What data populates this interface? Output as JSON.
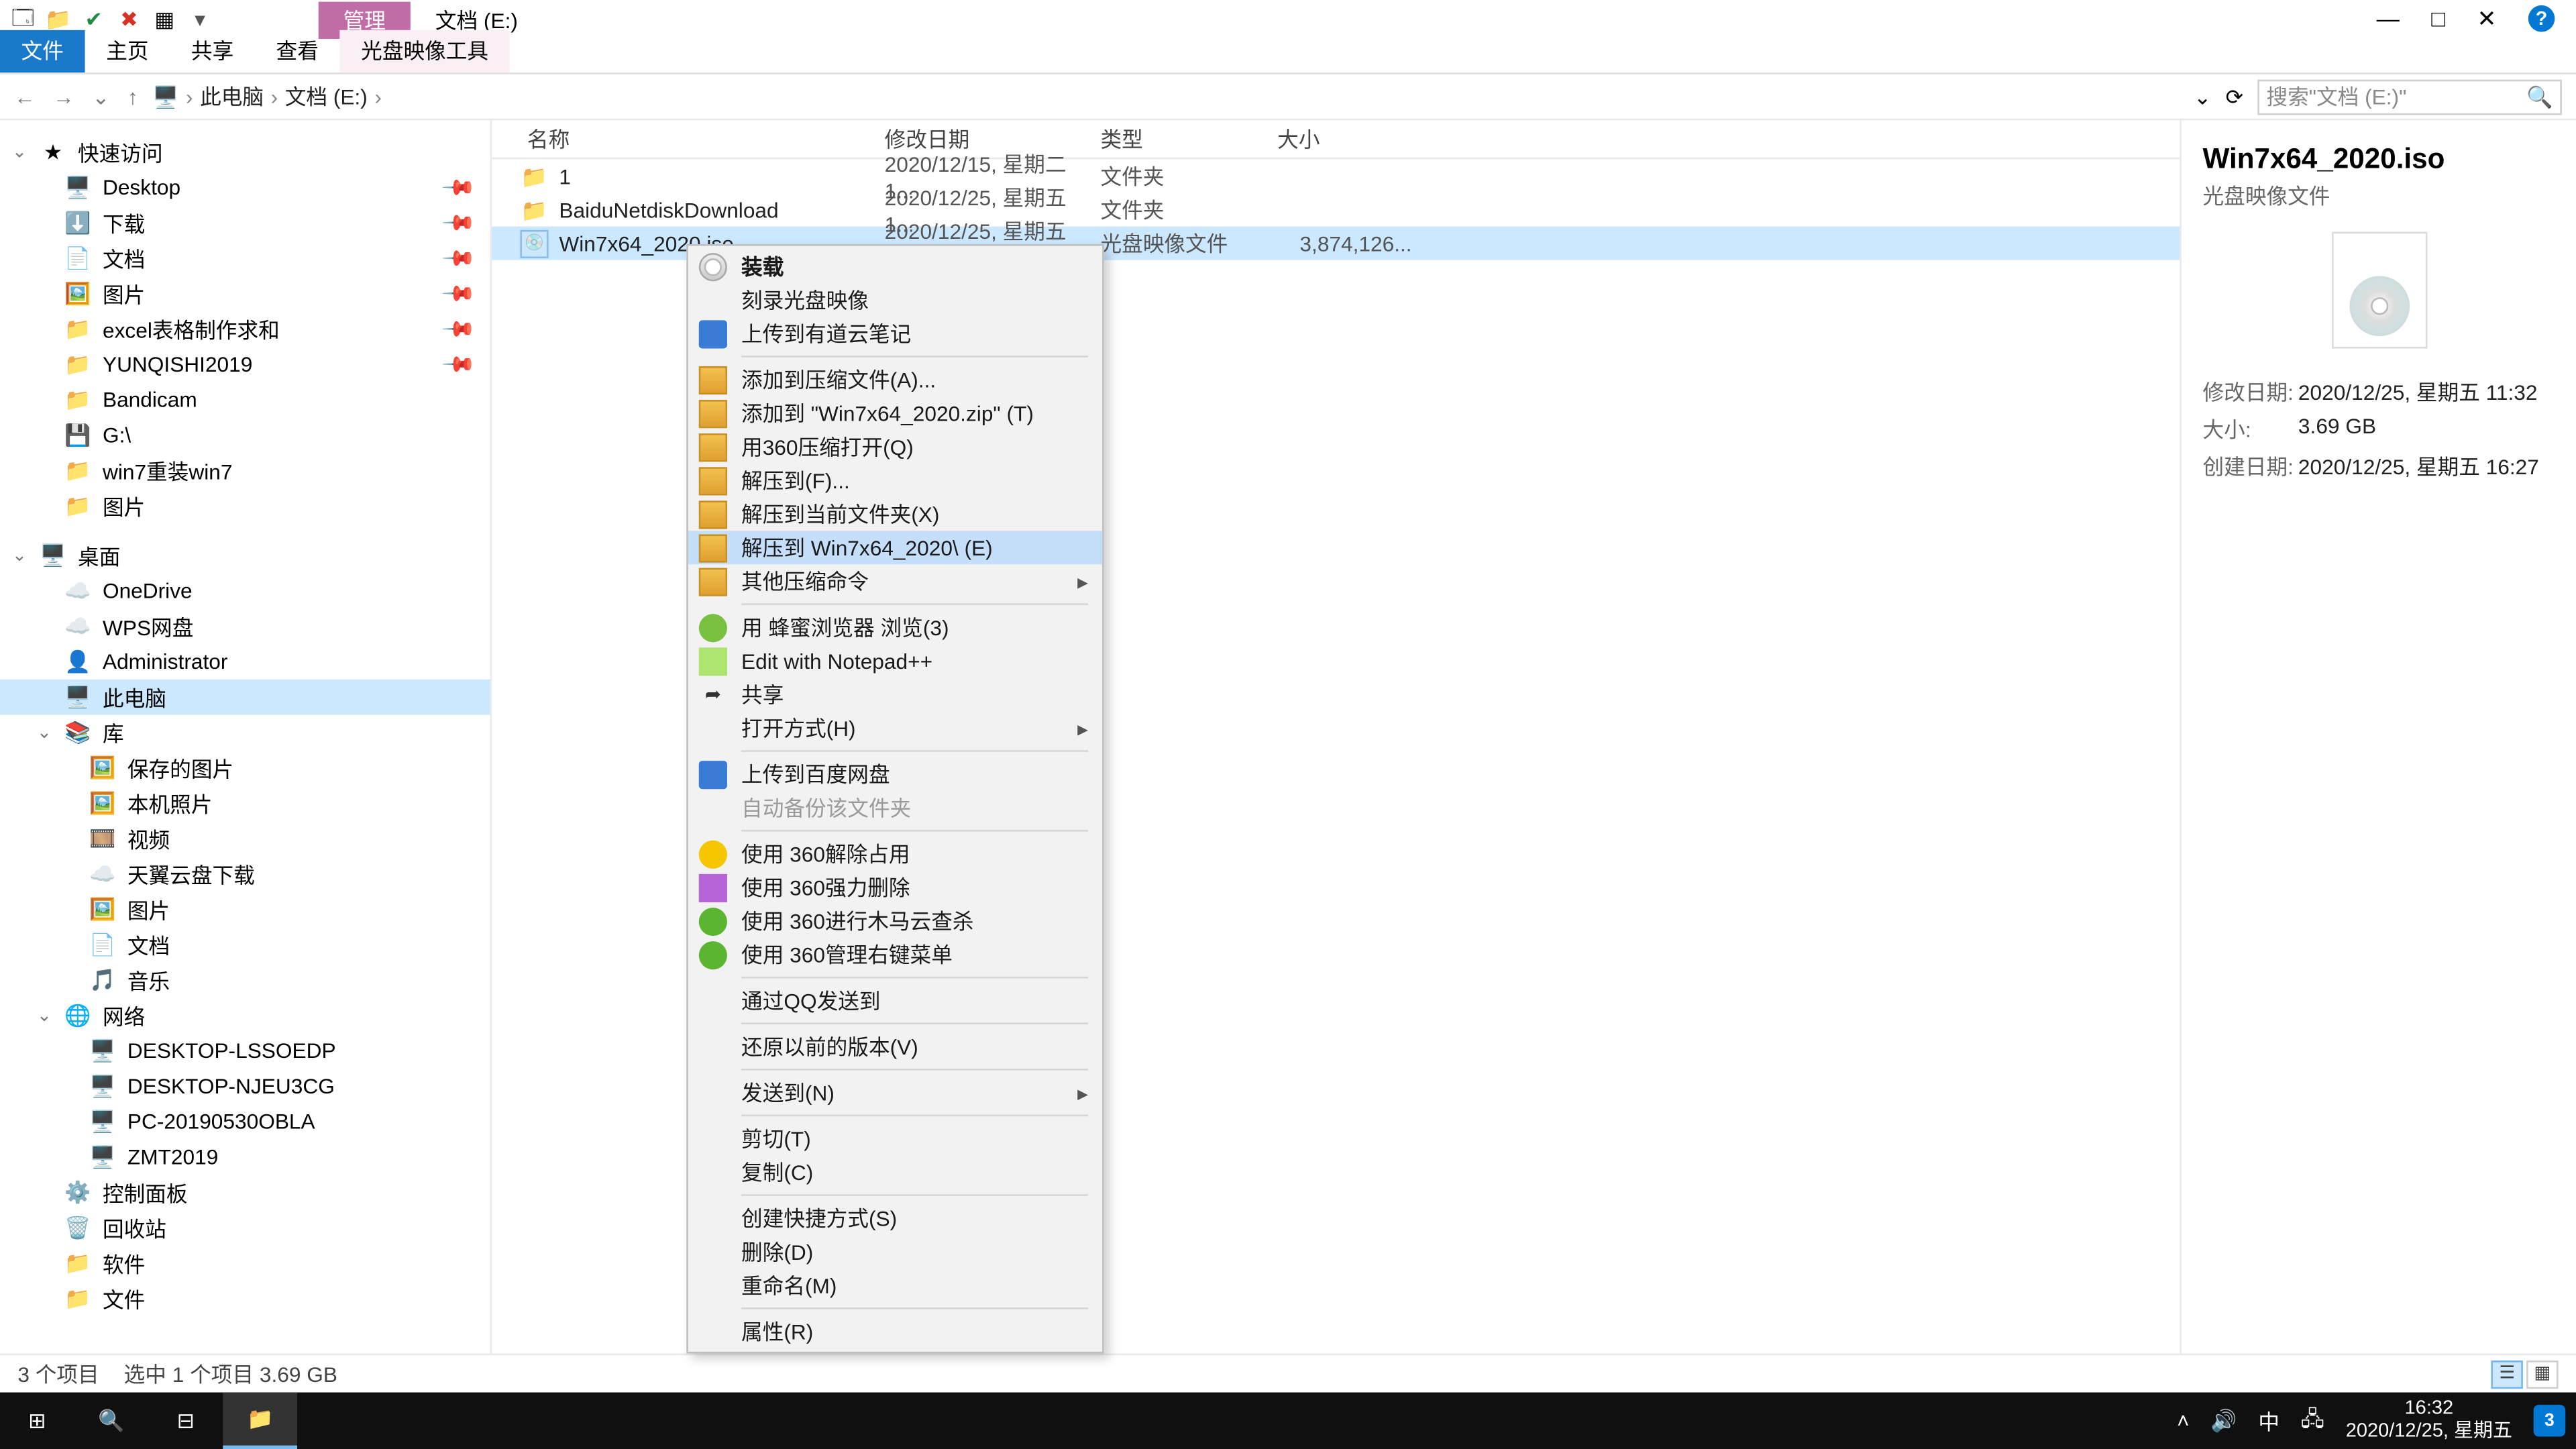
{
  "window": {
    "tabs_contextual": {
      "manage": "管理",
      "location": "文档 (E:)"
    },
    "ctl": {
      "min": "—",
      "max": "□",
      "close": "✕",
      "help": "?"
    }
  },
  "ribbon": {
    "file": "文件",
    "home": "主页",
    "share": "共享",
    "view": "查看",
    "disctools": "光盘映像工具"
  },
  "address": {
    "back": "←",
    "fwd": "→",
    "up": "↑",
    "crumbs": [
      "此电脑",
      "文档 (E:)"
    ],
    "dropdown": "⌄",
    "refresh": "⟳",
    "search_placeholder": "搜索\"文档 (E:)\"",
    "mag": "🔍"
  },
  "nav": {
    "quick": {
      "label": "快速访问",
      "items": [
        {
          "icon": "🖥️",
          "label": "Desktop",
          "pin": true
        },
        {
          "icon": "⬇️",
          "label": "下载",
          "pin": true
        },
        {
          "icon": "📄",
          "label": "文档",
          "pin": true
        },
        {
          "icon": "🖼️",
          "label": "图片",
          "pin": true
        },
        {
          "icon": "📁",
          "label": "excel表格制作求和",
          "pin": true
        },
        {
          "icon": "📁",
          "label": "YUNQISHI2019",
          "pin": true
        },
        {
          "icon": "📁",
          "label": "Bandicam"
        },
        {
          "icon": "💾",
          "label": "G:\\"
        },
        {
          "icon": "📁",
          "label": "win7重装win7"
        },
        {
          "icon": "📁",
          "label": "图片"
        }
      ]
    },
    "desktop": {
      "label": "桌面",
      "items": [
        {
          "icon": "☁️",
          "label": "OneDrive"
        },
        {
          "icon": "☁️",
          "label": "WPS网盘"
        },
        {
          "icon": "👤",
          "label": "Administrator"
        },
        {
          "icon": "🖥️",
          "label": "此电脑",
          "sel": true
        },
        {
          "icon": "📚",
          "label": "库",
          "expanded": true,
          "children": [
            {
              "icon": "🖼️",
              "label": "保存的图片"
            },
            {
              "icon": "🖼️",
              "label": "本机照片"
            },
            {
              "icon": "🎞️",
              "label": "视频"
            },
            {
              "icon": "☁️",
              "label": "天翼云盘下载"
            },
            {
              "icon": "🖼️",
              "label": "图片"
            },
            {
              "icon": "📄",
              "label": "文档"
            },
            {
              "icon": "🎵",
              "label": "音乐"
            }
          ]
        },
        {
          "icon": "🌐",
          "label": "网络",
          "expanded": true,
          "children": [
            {
              "icon": "🖥️",
              "label": "DESKTOP-LSSOEDP"
            },
            {
              "icon": "🖥️",
              "label": "DESKTOP-NJEU3CG"
            },
            {
              "icon": "🖥️",
              "label": "PC-20190530OBLA"
            },
            {
              "icon": "🖥️",
              "label": "ZMT2019"
            }
          ]
        },
        {
          "icon": "⚙️",
          "label": "控制面板"
        },
        {
          "icon": "🗑️",
          "label": "回收站"
        },
        {
          "icon": "📁",
          "label": "软件"
        },
        {
          "icon": "📁",
          "label": "文件"
        }
      ]
    }
  },
  "columns": {
    "name": "名称",
    "date": "修改日期",
    "type": "类型",
    "size": "大小"
  },
  "rows": [
    {
      "icon": "folder",
      "name": "1",
      "date": "2020/12/15, 星期二 1...",
      "type": "文件夹",
      "size": ""
    },
    {
      "icon": "folder",
      "name": "BaiduNetdiskDownload",
      "date": "2020/12/25, 星期五 1...",
      "type": "文件夹",
      "size": ""
    },
    {
      "icon": "iso",
      "name": "Win7x64_2020.iso",
      "date": "2020/12/25, 星期五 1...",
      "type": "光盘映像文件",
      "size": "3,874,126...",
      "sel": true
    }
  ],
  "details": {
    "title": "Win7x64_2020.iso",
    "sub": "光盘映像文件",
    "props": [
      {
        "k": "修改日期:",
        "v": "2020/12/25, 星期五 11:32"
      },
      {
        "k": "大小:",
        "v": "3.69 GB"
      },
      {
        "k": "创建日期:",
        "v": "2020/12/25, 星期五 16:27"
      }
    ]
  },
  "status": {
    "count": "3 个项目",
    "selection": "选中 1 个项目  3.69 GB"
  },
  "ctx": [
    {
      "t": "装载",
      "bold": true,
      "ico": "disc"
    },
    {
      "t": "刻录光盘映像"
    },
    {
      "t": "上传到有道云笔记",
      "ico": "bluebox"
    },
    {
      "sep": true
    },
    {
      "t": "添加到压缩文件(A)...",
      "ico": "archive"
    },
    {
      "t": "添加到 \"Win7x64_2020.zip\" (T)",
      "ico": "archive"
    },
    {
      "t": "用360压缩打开(Q)",
      "ico": "archive"
    },
    {
      "t": "解压到(F)...",
      "ico": "archive"
    },
    {
      "t": "解压到当前文件夹(X)",
      "ico": "archive"
    },
    {
      "t": "解压到 Win7x64_2020\\ (E)",
      "ico": "archive",
      "hov": true
    },
    {
      "t": "其他压缩命令",
      "ico": "archive",
      "sub": true
    },
    {
      "sep": true
    },
    {
      "t": "用 蜂蜜浏览器 浏览(3)",
      "ico": "green"
    },
    {
      "t": "Edit with Notepad++",
      "ico": "notepp"
    },
    {
      "t": "共享",
      "ico": "share"
    },
    {
      "t": "打开方式(H)",
      "sub": true
    },
    {
      "sep": true
    },
    {
      "t": "上传到百度网盘",
      "ico": "bluebox"
    },
    {
      "t": "自动备份该文件夹",
      "dis": true
    },
    {
      "sep": true
    },
    {
      "t": "使用 360解除占用",
      "ico": "yellow"
    },
    {
      "t": "使用 360强力删除",
      "ico": "purple"
    },
    {
      "t": "使用 360进行木马云查杀",
      "ico": "greenround"
    },
    {
      "t": "使用 360管理右键菜单",
      "ico": "greenround"
    },
    {
      "sep": true
    },
    {
      "t": "通过QQ发送到"
    },
    {
      "sep": true
    },
    {
      "t": "还原以前的版本(V)"
    },
    {
      "sep": true
    },
    {
      "t": "发送到(N)",
      "sub": true
    },
    {
      "sep": true
    },
    {
      "t": "剪切(T)"
    },
    {
      "t": "复制(C)"
    },
    {
      "sep": true
    },
    {
      "t": "创建快捷方式(S)"
    },
    {
      "t": "删除(D)"
    },
    {
      "t": "重命名(M)"
    },
    {
      "sep": true
    },
    {
      "t": "属性(R)"
    }
  ],
  "taskbar": {
    "tray": {
      "ime": "中",
      "time": "16:32",
      "date": "2020/12/25, 星期五",
      "badge": "3"
    }
  }
}
